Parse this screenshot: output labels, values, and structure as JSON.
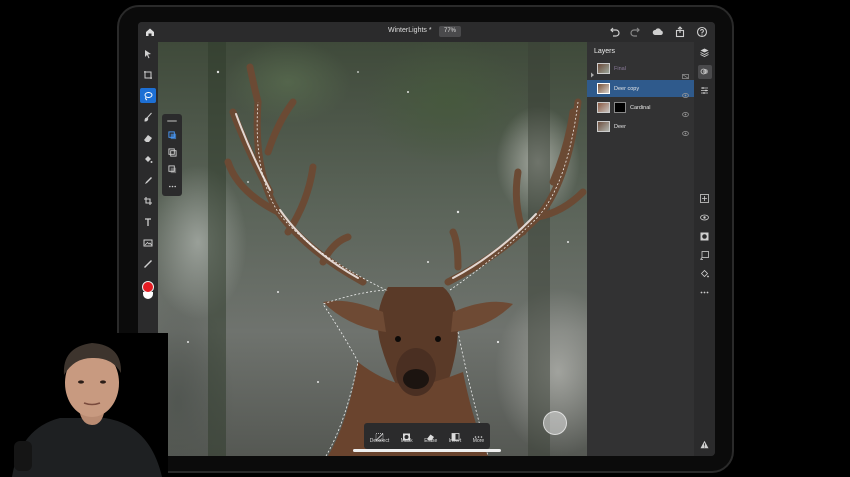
{
  "app": {
    "document_title": "WinterLights *",
    "zoom": "77%"
  },
  "layers_panel": {
    "title": "Layers",
    "layers": [
      {
        "name": "Final",
        "dim": true
      },
      {
        "name": "Deer copy",
        "selected": true
      },
      {
        "name": "Cardinal"
      },
      {
        "name": "Deer"
      }
    ]
  },
  "action_bar": {
    "items": [
      {
        "label": "Deselect",
        "icon": "deselect-icon"
      },
      {
        "label": "Mask",
        "icon": "mask-icon"
      },
      {
        "label": "Erase",
        "icon": "erase-icon"
      },
      {
        "label": "Invert",
        "icon": "invert-icon"
      },
      {
        "label": "More",
        "icon": "more-icon"
      }
    ]
  },
  "colors": {
    "accent": "#1d6fd4",
    "selected_layer": "#2f5a8c",
    "foreground_color": "#e51c23",
    "background_color": "#ffffff"
  }
}
